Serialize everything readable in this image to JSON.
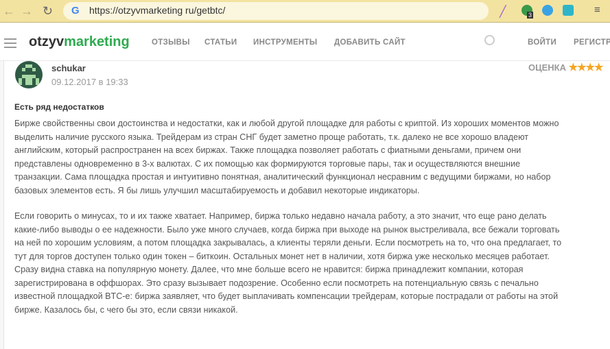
{
  "browser": {
    "url": "https://otzyvmarketing ru/getbtc/",
    "badge": "3"
  },
  "site": {
    "logo_a": "otzyv",
    "logo_b": "marketing",
    "menu": [
      "ОТЗЫВЫ",
      "СТАТЬИ",
      "ИНСТРУМЕНТЫ",
      "ДОБАВИТЬ САЙТ"
    ],
    "login": "ВОЙТИ",
    "register": "РЕГИСТР"
  },
  "review": {
    "user": "schukar",
    "date": "09.12.2017 в 19:33",
    "rating_label": "ОЦЕНКА",
    "stars": "★★★★",
    "title": "Есть ряд недостатков",
    "p1": [
      "Бирже свойственны свои достоинства и недостатки, как и любой другой площадке для работы с криптой. Из хороших моментов можно",
      "выделить наличие русского языка. Трейдерам из стран СНГ будет заметно проще работать, т.к. далеко не все хорошо владеют",
      "английским, который распространен на всех биржах. Также площадка позволяет работать с фиатными деньгами, причем они",
      "представлены одновременно в 3-х валютах. С их помощью как формируются торговые пары, так и осуществляются внешние",
      "транзакции. Сама площадка простая и интуитивно понятная, аналитический функционал несравним с ведущими биржами, но набор",
      "базовых элементов есть. Я бы лишь улучшил масштабируемость и добавил некоторые индикаторы."
    ],
    "p2": [
      "Если говорить о минусах, то и их также хватает. Например, биржа только недавно начала работу, а это значит, что еще рано делать",
      "какие-либо выводы о ее надежности. Было уже много случаев, когда биржа при выходе на рынок выстреливала, все бежали торговать",
      "на ней по хорошим условиям, а потом площадка закрывалась, а клиенты теряли деньги. Если посмотреть на то, что она предлагает, то",
      "тут для торгов доступен только один токен – биткоин. Остальных монет нет в наличии, хотя биржа уже несколько месяцев работает.",
      "Сразу видна ставка на популярную монету. Далее, что мне больше всего не нравится: биржа принадлежит компании, которая",
      "зарегистрирована в оффшорах. Это сразу вызывает подозрение. Особенно если посмотреть на потенциальную связь с печально",
      "известной площадкой BTC-e: биржа заявляет, что будет выплачивать компенсации трейдерам, которые пострадали от работы на этой",
      "бирже. Казалось бы, с чего бы это, если связи никакой."
    ]
  }
}
